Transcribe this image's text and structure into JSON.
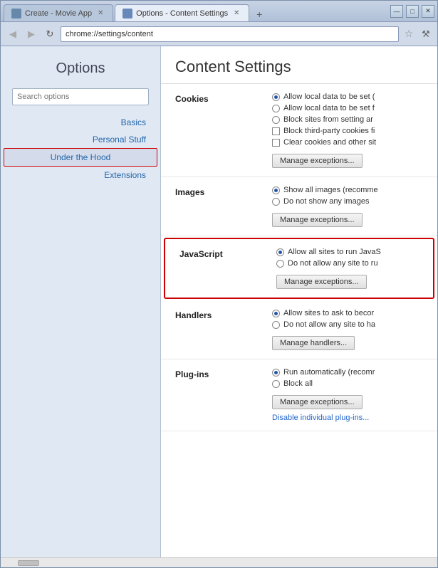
{
  "window": {
    "title_bar": {
      "tabs": [
        {
          "id": "tab1",
          "label": "Create - Movie App",
          "active": false,
          "icon": "movie"
        },
        {
          "id": "tab2",
          "label": "Options - Content Settings",
          "active": true,
          "icon": "settings"
        }
      ],
      "new_tab_btn": "+",
      "controls": [
        "—",
        "□",
        "✕"
      ]
    },
    "address_bar": {
      "back_btn": "◀",
      "forward_btn": "▶",
      "refresh_btn": "↻",
      "url": "chrome://settings/content",
      "star_btn": "☆",
      "wrench_btn": "🔧"
    }
  },
  "sidebar": {
    "title": "Options",
    "search_placeholder": "Search options",
    "nav_items": [
      {
        "id": "basics",
        "label": "Basics",
        "active": false
      },
      {
        "id": "personal",
        "label": "Personal Stuff",
        "active": false
      },
      {
        "id": "under-hood",
        "label": "Under the Hood",
        "active": true
      },
      {
        "id": "extensions",
        "label": "Extensions",
        "active": false
      }
    ]
  },
  "content": {
    "title": "Content Settings",
    "sections": [
      {
        "id": "cookies",
        "label": "Cookies",
        "options": [
          {
            "type": "radio",
            "selected": true,
            "text": "Allow local data to be set ("
          },
          {
            "type": "radio",
            "selected": false,
            "text": "Allow local data to be set f"
          },
          {
            "type": "radio",
            "selected": false,
            "text": "Block sites from setting ar"
          },
          {
            "type": "checkbox",
            "checked": false,
            "text": "Block third-party cookies fi"
          },
          {
            "type": "checkbox",
            "checked": false,
            "text": "Clear cookies and other sit"
          }
        ],
        "buttons": [
          {
            "id": "manage-exceptions-cookies",
            "label": "Manage exceptions..."
          }
        ]
      },
      {
        "id": "images",
        "label": "Images",
        "options": [
          {
            "type": "radio",
            "selected": true,
            "text": "Show all images (recomme"
          },
          {
            "type": "radio",
            "selected": false,
            "text": "Do not show any images"
          }
        ],
        "buttons": [
          {
            "id": "manage-exceptions-images",
            "label": "Manage exceptions..."
          }
        ]
      },
      {
        "id": "javascript",
        "label": "JavaScript",
        "highlighted": true,
        "options": [
          {
            "type": "radio",
            "selected": true,
            "text": "Allow all sites to run JavaS"
          },
          {
            "type": "radio",
            "selected": false,
            "text": "Do not allow any site to ru"
          }
        ],
        "buttons": [
          {
            "id": "manage-exceptions-js",
            "label": "Manage exceptions..."
          }
        ]
      },
      {
        "id": "handlers",
        "label": "Handlers",
        "options": [
          {
            "type": "radio",
            "selected": true,
            "text": "Allow sites to ask to becor"
          },
          {
            "type": "radio",
            "selected": false,
            "text": "Do not allow any site to ha"
          }
        ],
        "buttons": [
          {
            "id": "manage-handlers",
            "label": "Manage handlers..."
          }
        ]
      },
      {
        "id": "plugins",
        "label": "Plug-ins",
        "options": [
          {
            "type": "radio",
            "selected": true,
            "text": "Run automatically (recomr"
          },
          {
            "type": "radio",
            "selected": false,
            "text": "Block all"
          }
        ],
        "buttons": [
          {
            "id": "manage-exceptions-plugins",
            "label": "Manage exceptions..."
          }
        ],
        "links": [
          {
            "id": "disable-plugins-link",
            "text": "Disable individual plug-ins..."
          }
        ]
      }
    ]
  }
}
